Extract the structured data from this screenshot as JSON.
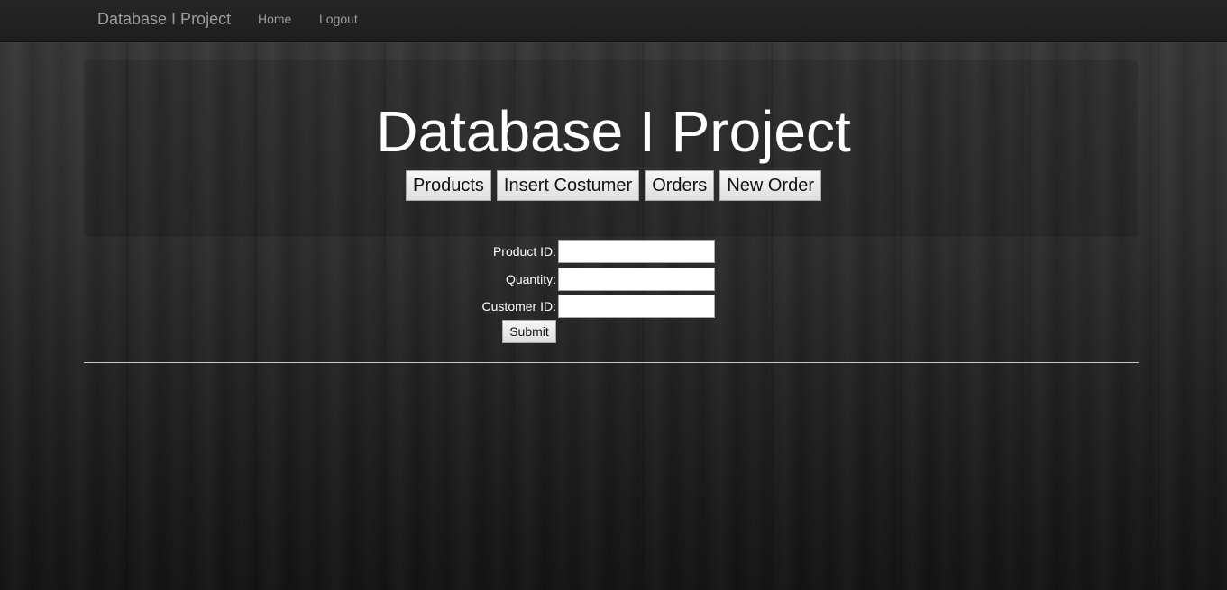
{
  "navbar": {
    "brand": "Database I Project",
    "links": [
      "Home",
      "Logout"
    ]
  },
  "header": {
    "title": "Database I Project",
    "buttons": [
      "Products",
      "Insert Costumer",
      "Orders",
      "New Order"
    ]
  },
  "form": {
    "fields": [
      {
        "label": "Product ID:",
        "value": ""
      },
      {
        "label": "Quantity:",
        "value": ""
      },
      {
        "label": "Customer ID:",
        "value": ""
      }
    ],
    "submit_label": "Submit"
  }
}
